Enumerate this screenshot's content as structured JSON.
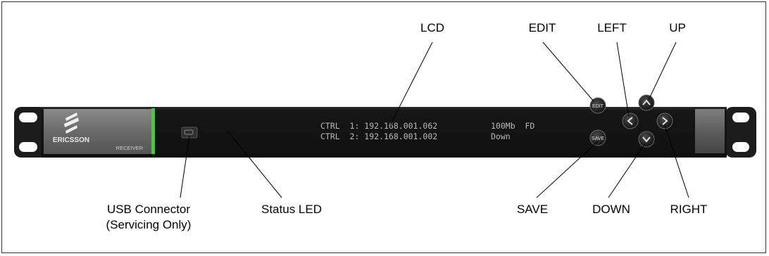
{
  "device": {
    "brand": "ERICSSON",
    "model": "RECEIVER"
  },
  "lcd": {
    "line1_left": "CTRL  1: 192.168.001.062",
    "line1_right": "100Mb  FD",
    "line2_left": "CTRL  2: 192.168.001.002",
    "line2_right": "Down"
  },
  "buttons": {
    "edit": "EDIT",
    "save": "SAVE"
  },
  "callouts": {
    "lcd": "LCD",
    "edit": "EDIT",
    "left": "LEFT",
    "up": "UP",
    "save": "SAVE",
    "down": "DOWN",
    "right": "RIGHT",
    "usb_line1": "USB Connector",
    "usb_line2": "(Servicing Only)",
    "status_led": "Status LED"
  },
  "colors": {
    "status_led": "#3ad42a",
    "panel": "#151515",
    "ears": "#1c1c1c"
  }
}
